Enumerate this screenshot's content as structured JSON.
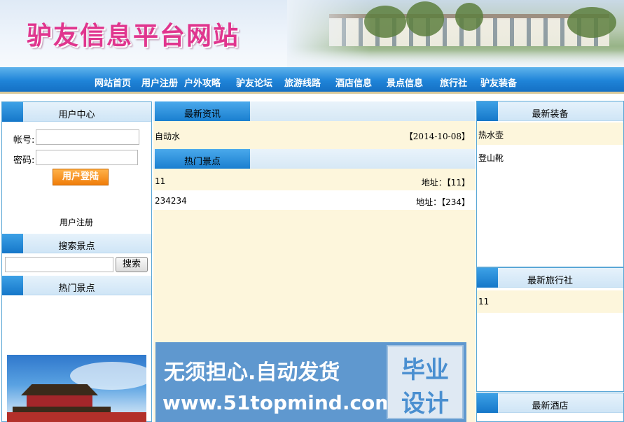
{
  "header": {
    "title": "驴友信息平台网站"
  },
  "nav": {
    "items": [
      "网站首页",
      "用户注册",
      "户外攻略",
      "驴友论坛",
      "旅游线路",
      "酒店信息",
      "景点信息",
      "旅行社",
      "驴友装备"
    ]
  },
  "left": {
    "user_center": {
      "title": "用户中心",
      "account_label": "帐号:",
      "password_label": "密码:",
      "login_button": "用户登陆",
      "register_link": "用户注册"
    },
    "search": {
      "title": "搜索景点",
      "button": "搜索",
      "query": ""
    },
    "hot": {
      "title": "热门景点"
    }
  },
  "main": {
    "news": {
      "title": "最新资讯",
      "items": [
        {
          "text": "自动水",
          "date": "【2014-10-08】"
        }
      ]
    },
    "hot_spots": {
      "title": "热门景点",
      "items": [
        {
          "name": "11",
          "address": "地址：【11】"
        },
        {
          "name": "234234",
          "address": "地址：【234】"
        }
      ]
    },
    "ad": {
      "line1": "无须担心.自动发货",
      "line2": "www.51topmind.com",
      "badge_top": "毕业",
      "badge_bottom": "设计"
    }
  },
  "right": {
    "equipment": {
      "title": "最新装备",
      "items": [
        "热水壶",
        "登山靴"
      ]
    },
    "agencies": {
      "title": "最新旅行社",
      "items": [
        "11"
      ]
    },
    "hotels": {
      "title": "最新酒店"
    }
  }
}
